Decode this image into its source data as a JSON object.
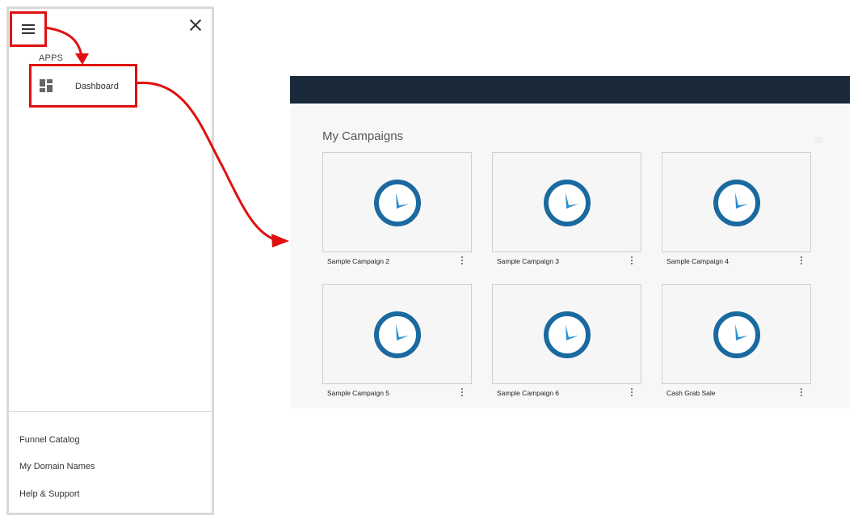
{
  "drawer": {
    "section_label": "APPS",
    "apps": [
      {
        "label": "Dashboard",
        "icon": "dashboard-icon"
      }
    ],
    "footer_links": [
      {
        "label": "Funnel Catalog"
      },
      {
        "label": "My Domain Names"
      },
      {
        "label": "Help & Support"
      }
    ],
    "highlight_color": "#e01010"
  },
  "main": {
    "title": "My Campaigns",
    "topbar_color": "#1b2a3a",
    "campaigns": [
      {
        "name": "Sample Campaign 2",
        "icon": "clock-icon"
      },
      {
        "name": "Sample Campaign 3",
        "icon": "clock-icon"
      },
      {
        "name": "Sample Campaign 4",
        "icon": "clock-icon"
      },
      {
        "name": "Sample Campaign 5",
        "icon": "clock-icon"
      },
      {
        "name": "Sample Campaign 6",
        "icon": "clock-icon"
      },
      {
        "name": "Cash Grab Sale",
        "icon": "clock-icon"
      }
    ],
    "clock_color": "#1a6aa0"
  }
}
